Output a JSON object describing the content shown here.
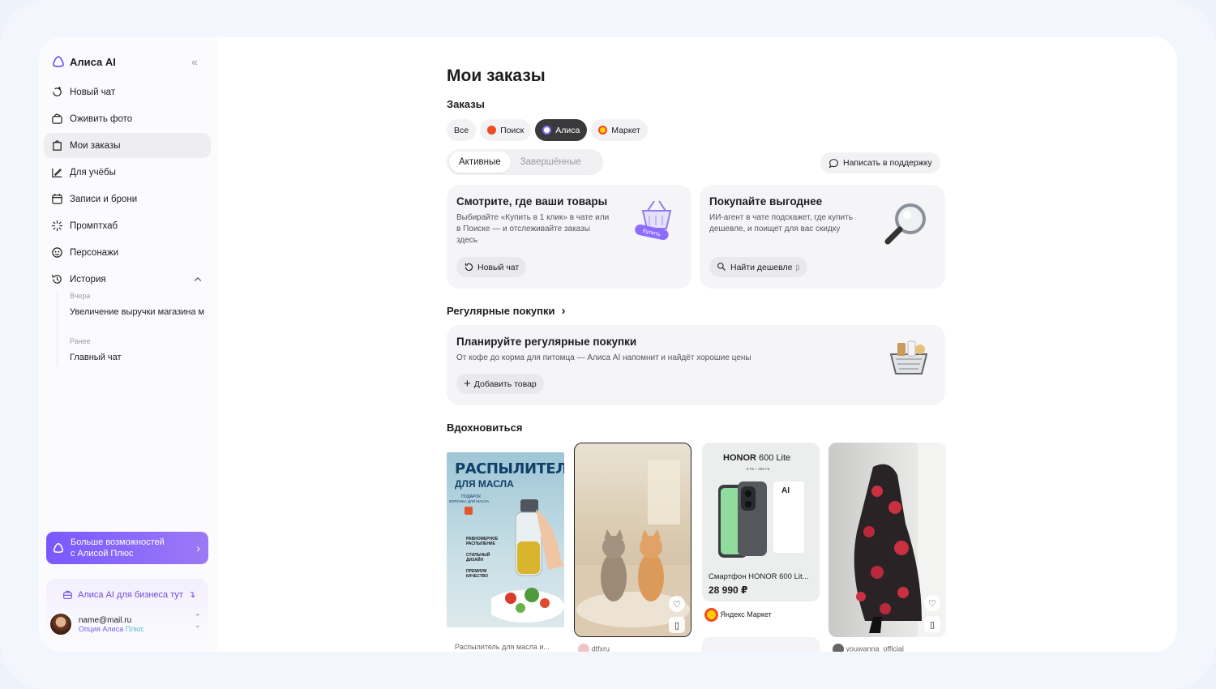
{
  "sidebar": {
    "brand": "Алиса AI",
    "items": [
      {
        "label": "Новый чат",
        "icon": "new-chat-icon"
      },
      {
        "label": "Оживить фото",
        "icon": "animate-photo-icon"
      },
      {
        "label": "Мои заказы",
        "icon": "orders-icon",
        "active": true
      },
      {
        "label": "Для учёбы",
        "icon": "study-icon"
      },
      {
        "label": "Записи и брони",
        "icon": "calendar-icon"
      },
      {
        "label": "Промптхаб",
        "icon": "sparkle-icon"
      },
      {
        "label": "Персонажи",
        "icon": "characters-icon"
      },
      {
        "label": "История",
        "icon": "history-icon"
      }
    ],
    "history": {
      "yesterday_label": "Вчера",
      "yesterday_item": "Увеличение выручки магазина м",
      "earlier_label": "Ранее",
      "earlier_item": "Главный чат"
    },
    "plus_card": {
      "line1": "Больше возможностей",
      "line2": "с Алисой Плюс"
    },
    "business_link": "Алиса AI для бизнеса тут",
    "user": {
      "email": "name@mail.ru",
      "option_prefix": "Опция Алиса ",
      "option_plus": "Плюс"
    }
  },
  "main": {
    "title": "Мои заказы",
    "orders_heading": "Заказы",
    "filters": [
      {
        "label": "Все"
      },
      {
        "label": "Поиск",
        "color": "#f04b24"
      },
      {
        "label": "Алиса",
        "active": true,
        "color": "#8b6cff"
      },
      {
        "label": "Маркет",
        "color": "#ffcc00"
      }
    ],
    "tabs": {
      "active": "Активные",
      "done": "Завершённые"
    },
    "support": "Написать в поддержку",
    "promo1": {
      "title": "Смотрите, где ваши товары",
      "text1": "Выбирайте «Купить в 1 клик» в чате или",
      "text2": "в Поиске — и отслеживайте заказы",
      "text3": "здесь",
      "button": "Новый чат",
      "badge": "Купить"
    },
    "promo2": {
      "title": "Покупайте выгоднее",
      "text1": "ИИ-агент в чате подскажет, где купить",
      "text2": "дешевле, и поищет для вас скидку",
      "button": "Найти дешевле",
      "beta": "β"
    },
    "regular_heading": "Регулярные покупки",
    "regular_card": {
      "title": "Планируйте регулярные покупки",
      "text": "От кофе до корма для питомца — Алиса AI напомнит и найдёт хорошие цены",
      "button": "Добавить товар"
    },
    "inspire_heading": "Вдохновиться",
    "feed": {
      "tile1": {
        "title1": "РАСПЫЛИТЕЛЬ",
        "title2": "ДЛЯ МАСЛА",
        "gift": "ПОДАРОК",
        "gift2": "ВОРОНКА ДЛЯ МАСЛА",
        "f1": "РАВНОМЕРНОЕ РАСПЫЛЕНИЕ",
        "f2": "СТИЛЬНЫЙ ДИЗАЙН",
        "f3": "ПРЕМИУМ КАЧЕСТВО",
        "caption": "Распылитель для масла и..."
      },
      "tile2": {
        "author": "dtfxru"
      },
      "tile3": {
        "brand": "HONOR",
        "model": " 600 Lite",
        "specs": "8 ГБ + 256 ГБ",
        "ai": "AI",
        "product": "Смартфон HONOR 600 Lit...",
        "price": "28 990 ₽",
        "store": "Яндекс Маркет"
      },
      "tile4": {
        "author": "youwanna_official"
      }
    }
  }
}
